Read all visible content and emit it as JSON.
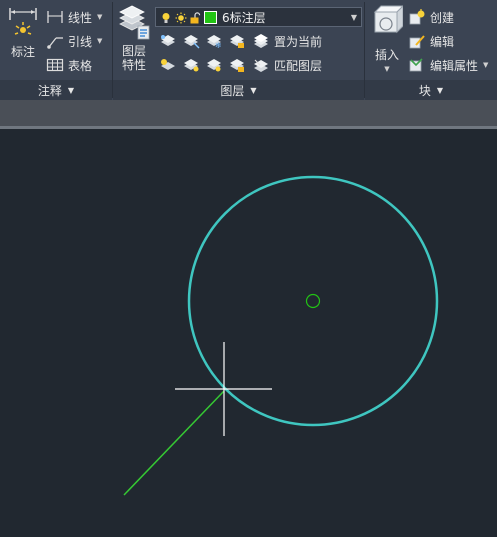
{
  "ribbon": {
    "annotation_panel": {
      "title": "注释",
      "dimension_label": "标注",
      "linear_label": "线性",
      "leader_label": "引线",
      "table_label": "表格"
    },
    "layers_panel": {
      "title": "图层",
      "layer_properties_label_line1": "图层",
      "layer_properties_label_line2": "特性",
      "current_layer": "6标注层",
      "current_layer_color": "#22c414",
      "set_current_label": "置为当前",
      "match_layer_label": "匹配图层"
    },
    "block_panel": {
      "title": "块",
      "insert_label": "插入",
      "create_label": "创建",
      "edit_label": "编辑",
      "edit_attributes_label": "编辑属性"
    }
  },
  "canvas": {
    "background": "#212830",
    "circle_color": "#3fc6c0",
    "center_mark_color": "#22c414",
    "line_color": "#35c833",
    "crosshair_color": "#ffffff"
  }
}
